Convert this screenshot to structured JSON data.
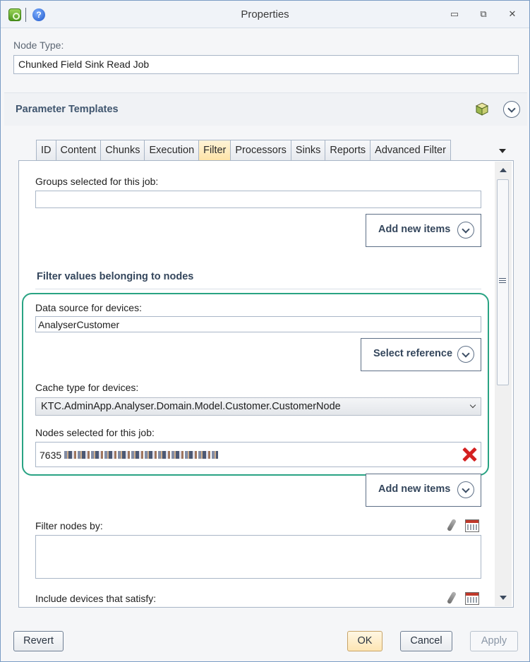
{
  "window": {
    "title": "Properties",
    "controls": {
      "minimize": "▭",
      "restore": "⧉",
      "close": "✕"
    }
  },
  "node_type": {
    "label": "Node Type:",
    "value": "Chunked Field Sink Read Job"
  },
  "section": {
    "title": "Parameter Templates"
  },
  "tabs": [
    {
      "label": "ID",
      "active": false
    },
    {
      "label": "Content",
      "active": false
    },
    {
      "label": "Chunks",
      "active": false
    },
    {
      "label": "Execution",
      "active": false
    },
    {
      "label": "Filter",
      "active": true
    },
    {
      "label": "Processors",
      "active": false
    },
    {
      "label": "Sinks",
      "active": false
    },
    {
      "label": "Reports",
      "active": false
    },
    {
      "label": "Advanced Filter",
      "active": false
    }
  ],
  "filter": {
    "groups_label": "Groups selected for this job:",
    "groups_value": "",
    "add_new_items_label": "Add new items",
    "nodes_heading": "Filter values belonging to nodes",
    "data_source_label": "Data source for devices:",
    "data_source_value": "AnalyserCustomer",
    "select_reference_label": "Select reference",
    "cache_type_label": "Cache type for devices:",
    "cache_type_value": "KTC.AdminApp.Analyser.Domain.Model.Customer.CustomerNode",
    "nodes_selected_label": "Nodes selected for this job:",
    "nodes_selected_prefix": "7635",
    "add_new_items_label_2": "Add new items",
    "filter_nodes_label": "Filter nodes by:",
    "include_devices_label": "Include devices that satisfy:"
  },
  "footer": {
    "revert": "Revert",
    "ok": "OK",
    "cancel": "Cancel",
    "apply": "Apply"
  },
  "colors": {
    "highlight": "#29a383",
    "accent": "#34465c",
    "active_tab": "#fde3a6",
    "remove": "#d42020"
  }
}
